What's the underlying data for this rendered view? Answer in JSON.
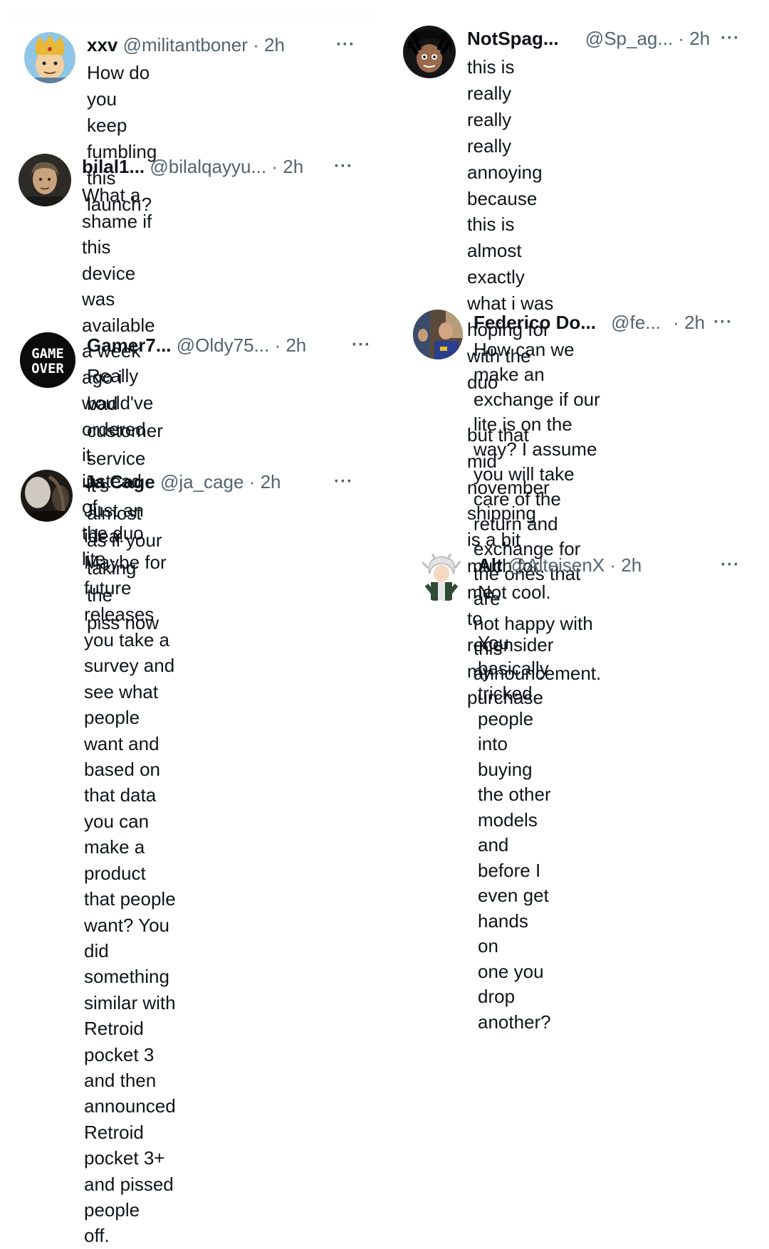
{
  "left_column": [
    {
      "name": "xxv",
      "handle": "@militantboner",
      "time": "2h",
      "text": "How do you keep fumbling\nthis launch?",
      "avatar": "cartoon-character-with-crown"
    },
    {
      "name": "bilal1...",
      "handle": "@bilalqayyu...",
      "time": "2h",
      "text": "What a shame if this device\nwas available a week ago i\nwould've ordered it instead of\nthe duo lite",
      "avatar": "man-portrait-dark"
    },
    {
      "name": "Gamer7...",
      "handle": "@Oldy75...",
      "time": "2h",
      "text": "Really bad customer service\nit's almost as if your taking the\npiss now",
      "avatar": "game-over-logo",
      "avatar_text": [
        "GAME",
        "OVER"
      ]
    },
    {
      "name": "Ja Cage",
      "handle": "@ja_cage",
      "time": "2h",
      "text": "Just an idea. Maybe for future\nreleases you take a survey and\nsee what people want and\nbased on that data you can\nmake a product that people\nwant? You did something\nsimilar with Retroid pocket 3\nand then announced Retroid\npocket 3+ and pissed people\noff.",
      "avatar": "dark-photo-silhouette"
    }
  ],
  "right_column": [
    {
      "name": "NotSpag...",
      "handle": "@Sp_ag...",
      "time": "2h",
      "text": "this is really really really\nannoying because this is\nalmost exactly what i was\nhoping for with the duo\n\nbut that mid november\nshipping is a bit much for me\nto reconsider my purchase",
      "avatar": "anime-character-dark-hair"
    },
    {
      "name": "Federico Do...",
      "handle": "@fe...",
      "time": "2h",
      "text": "How can we make an\nexchange if our lite is on the\nway? I assume you will take\ncare of the return and\nexchange for the ones that are\nnot happy with this\nannouncement.",
      "avatar": "person-in-room-photo"
    },
    {
      "name": "Alt",
      "handle": "@AlteisenX",
      "time": "2h",
      "text": "Not cool.\n\nYou basically tricked people\ninto buying the other models\nand before I even get hands on\none you drop another?",
      "avatar": "anime-character-white-hair"
    }
  ],
  "separator": "·",
  "more_icon": "···",
  "colors": {
    "text": "#0f1419",
    "secondary": "#536471",
    "divider": "#eff3f4"
  }
}
